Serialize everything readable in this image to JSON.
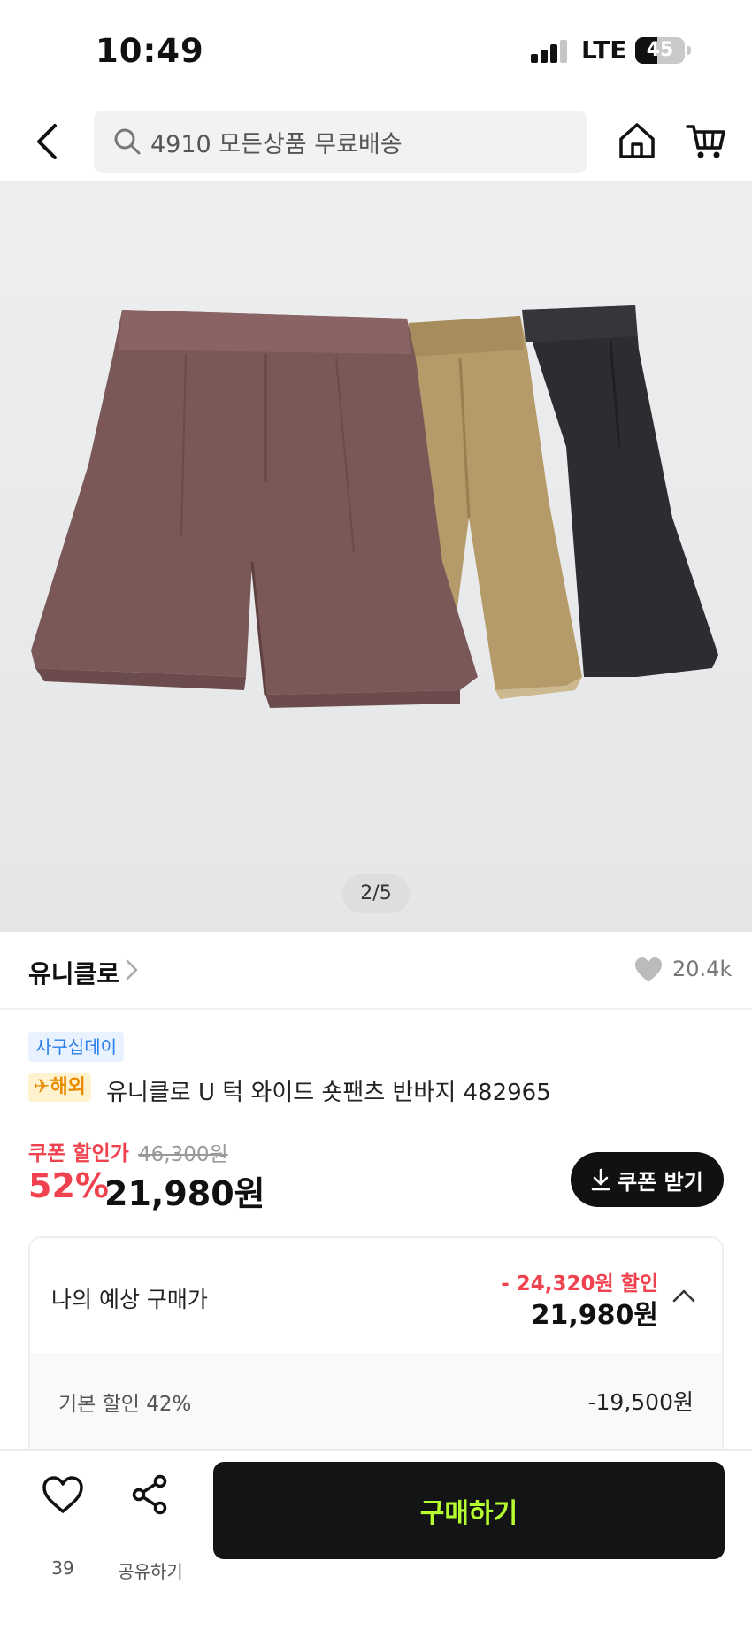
{
  "status_bar": {
    "time": "10:49",
    "network": "LTE",
    "battery_level": "45",
    "battery_percent": 45
  },
  "header": {
    "search_placeholder": "4910 모든상품 무료배송",
    "icons": [
      "back-icon",
      "search-icon",
      "home-icon",
      "cart-icon"
    ]
  },
  "gallery": {
    "pager": "2/5"
  },
  "brand": {
    "name": "유니클로",
    "like_count": "20.4k"
  },
  "product": {
    "event_tag": "사구십데이",
    "overseas_tag": "해외",
    "title": "유니클로 U 턱 와이드 숏팬츠 반바지 482965"
  },
  "price": {
    "coupon_label": "쿠폰 할인가",
    "original_price": "46,300원",
    "discount_rate": "52%",
    "sale_price": "21,980원",
    "coupon_button": "쿠폰 받기"
  },
  "estimate": {
    "label": "나의 예상 구매가",
    "discount_text": "- 24,320원 할인",
    "price": "21,980원",
    "details": [
      {
        "label": "기본 할인 42%",
        "value": "-19,500원"
      }
    ]
  },
  "bottom_bar": {
    "wish_count": "39",
    "share_label": "공유하기",
    "buy_label": "구매하기"
  },
  "colors": {
    "accent_red": "#f0424e",
    "buy_text": "#b6ff2e",
    "dark": "#131416",
    "tag_blue": "#2b7de9",
    "tag_orange": "#e98b00"
  }
}
